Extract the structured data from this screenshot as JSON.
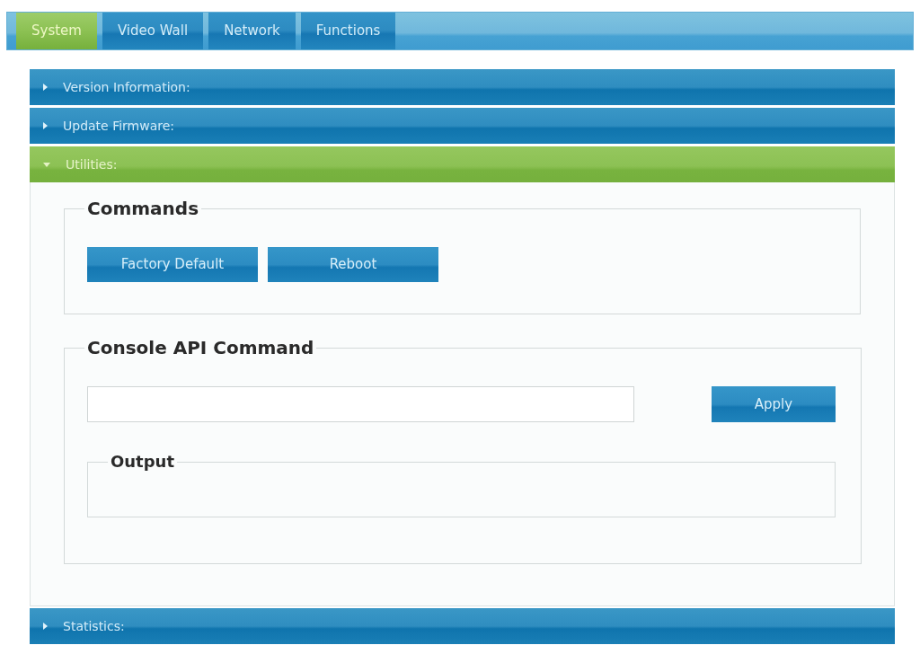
{
  "tabs": [
    {
      "label": "System",
      "selected": true
    },
    {
      "label": "Video Wall",
      "selected": false
    },
    {
      "label": "Network",
      "selected": false
    },
    {
      "label": "Functions",
      "selected": false
    }
  ],
  "sections": [
    {
      "title": "Version Information:",
      "expanded": false
    },
    {
      "title": "Update Firmware:",
      "expanded": false
    },
    {
      "title": "Utilities:",
      "expanded": true,
      "groups": [
        {
          "kind": "commands",
          "legend": "Commands",
          "buttons": [
            "Factory Default",
            "Reboot"
          ]
        },
        {
          "kind": "console",
          "legend": "Console API Command",
          "button": "Apply",
          "output": {
            "legend": "Output"
          }
        }
      ]
    },
    {
      "title": "Statistics:",
      "expanded": false
    }
  ]
}
